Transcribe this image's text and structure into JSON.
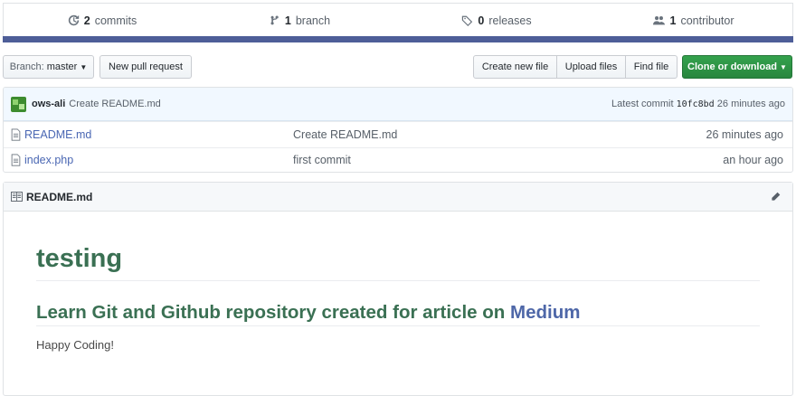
{
  "summary": {
    "commits_count": "2",
    "commits_label": "commits",
    "branch_count": "1",
    "branch_label": "branch",
    "releases_count": "0",
    "releases_label": "releases",
    "contributor_count": "1",
    "contributor_label": "contributor",
    "language_bar_color": "#4e5e98"
  },
  "toolbar": {
    "branch_prefix": "Branch:",
    "branch_name": "master",
    "new_pull_request": "New pull request",
    "create_new_file": "Create new file",
    "upload_files": "Upload files",
    "find_file": "Find file",
    "clone_or_download": "Clone or download"
  },
  "latest_commit": {
    "author": "ows-ali",
    "message": "Create README.md",
    "prefix": "Latest commit",
    "sha": "10fc8bd",
    "age": "26 minutes ago"
  },
  "files": [
    {
      "name": "README.md",
      "commit": "Create README.md",
      "age": "26 minutes ago",
      "icon": "file-icon"
    },
    {
      "name": "index.php",
      "commit": "first commit",
      "age": "an hour ago",
      "icon": "file-icon"
    }
  ],
  "readme": {
    "title": "README.md",
    "h1": "testing",
    "h2_text": "Learn Git and Github repository created for article on",
    "h2_link": "Medium",
    "paragraph": "Happy Coding!"
  },
  "colors": {
    "accent_green": "#28a745",
    "link_blue": "#4a67b3",
    "heading_green": "#3a7053"
  }
}
